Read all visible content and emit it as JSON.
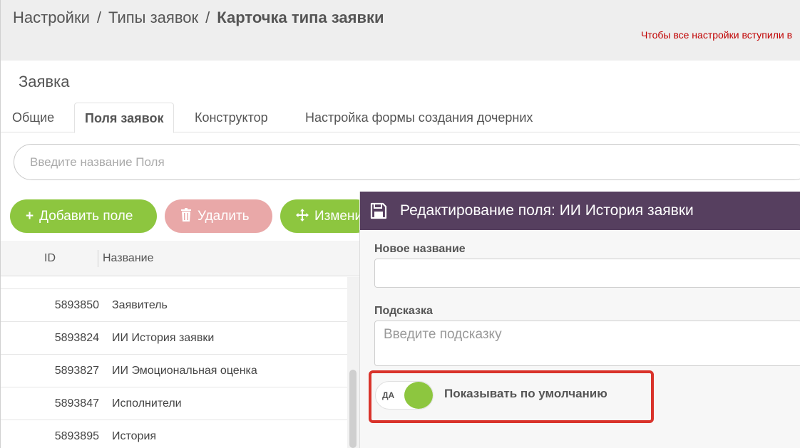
{
  "breadcrumb": {
    "items": [
      "Настройки",
      "Типы заявок"
    ],
    "current": "Карточка типа заявки",
    "separator": "/"
  },
  "notice": "Чтобы все настройки вступили в",
  "section_title": "Заявка",
  "tabs": [
    {
      "label": "Общие",
      "active": false
    },
    {
      "label": "Поля заявок",
      "active": true
    },
    {
      "label": "Конструктор",
      "active": false
    },
    {
      "label": "Настройка формы создания дочерних",
      "active": false
    }
  ],
  "search": {
    "placeholder": "Введите название Поля",
    "value": ""
  },
  "toolbar": {
    "add_label": "Добавить поле",
    "delete_label": "Удалить",
    "move_label": "Изменить"
  },
  "table": {
    "columns": [
      "ID",
      "Название"
    ],
    "rows": [
      {
        "id": "",
        "name": ""
      },
      {
        "id": "5893850",
        "name": "Заявитель"
      },
      {
        "id": "5893824",
        "name": "ИИ История заявки"
      },
      {
        "id": "5893827",
        "name": "ИИ Эмоциональная оценка"
      },
      {
        "id": "5893847",
        "name": "Исполнители"
      },
      {
        "id": "5893895",
        "name": "История"
      }
    ]
  },
  "modal": {
    "title": "Редактирование поля: ИИ История заявки",
    "new_name_label": "Новое название",
    "new_name_value": "",
    "hint_label": "Подсказка",
    "hint_placeholder": "Введите подсказку",
    "toggle_state": "ДА",
    "toggle_on": true,
    "toggle_label": "Показывать по умолчанию"
  },
  "colors": {
    "accent_green": "#8dc63f",
    "danger_light": "#e9a8a8",
    "modal_header": "#563f5f",
    "highlight": "#d9332b",
    "notice": "#c00000"
  }
}
